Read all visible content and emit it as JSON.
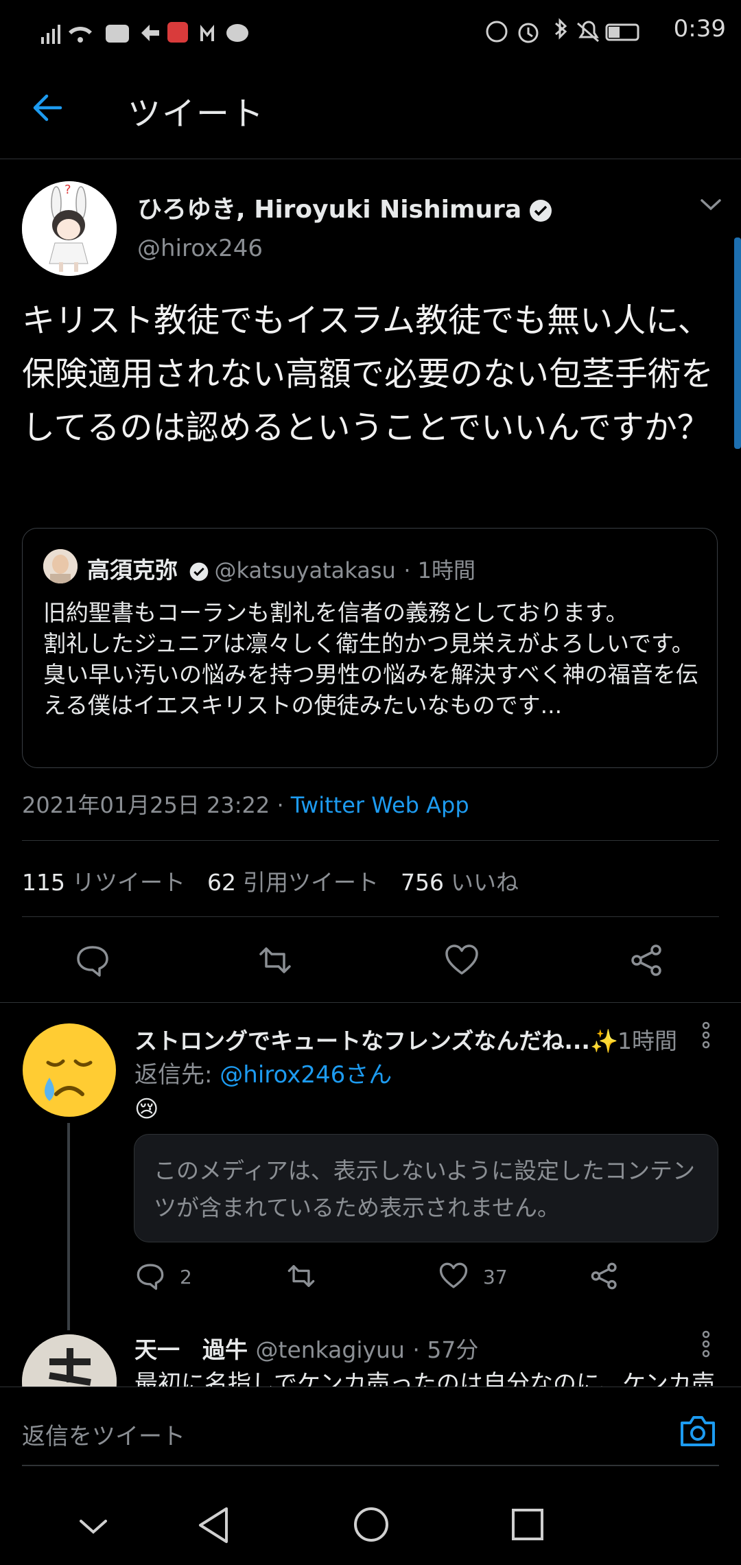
{
  "status_bar": {
    "time": "0:39"
  },
  "header": {
    "title": "ツイート"
  },
  "tweet": {
    "display_name": "ひろゆき, Hiroyuki Nishimura",
    "handle": "@hirox246",
    "text": "キリスト教徒でもイスラム教徒でも無い人に、保険適用されない高額で必要のない包茎手術をしてるのは認めるということでいいんですか？",
    "quote": {
      "display_name": "高須克弥",
      "handle": "@katsuyatakasu",
      "time": "· 1時間",
      "text_lines": [
        "旧約聖書もコーランも割礼を信者の義務としております。",
        "割礼したジュニアは凛々しく衛生的かつ見栄えがよろしいです。",
        "臭い早い汚いの悩みを持つ男性の悩みを解決すべく神の福音を伝える僕はイエスキリストの使徒みたいなものです..."
      ]
    },
    "timestamp": "2021年01月25日 23:22 ·",
    "source": "Twitter Web App",
    "stats": {
      "retweets": "115",
      "retweets_label": "リツイート",
      "quotes": "62",
      "quotes_label": "引用ツイート",
      "likes": "756",
      "likes_label": "いいね"
    }
  },
  "replies": [
    {
      "display_name": "ストロングでキュートなフレンズなんだね...✨",
      "time": "1時間",
      "reply_to_prefix": "返信先: ",
      "reply_to": "@hirox246さん",
      "emoji": "😢",
      "media_notice": "このメディアは、表示しないように設定したコンテンツが含まれているため表示されません。",
      "reply_count": "2",
      "like_count": "37"
    },
    {
      "display_name": "天一　過牛",
      "handle": "@tenkagiyuu",
      "time": "· 57分",
      "text": "最初に名指しでケンカ売ったのは自分なのに、ケンカ売"
    }
  ],
  "composer": {
    "placeholder": "返信をツイート"
  },
  "colors": {
    "accent": "#1d9bf0",
    "background": "#000000",
    "muted": "#8b8f94"
  }
}
